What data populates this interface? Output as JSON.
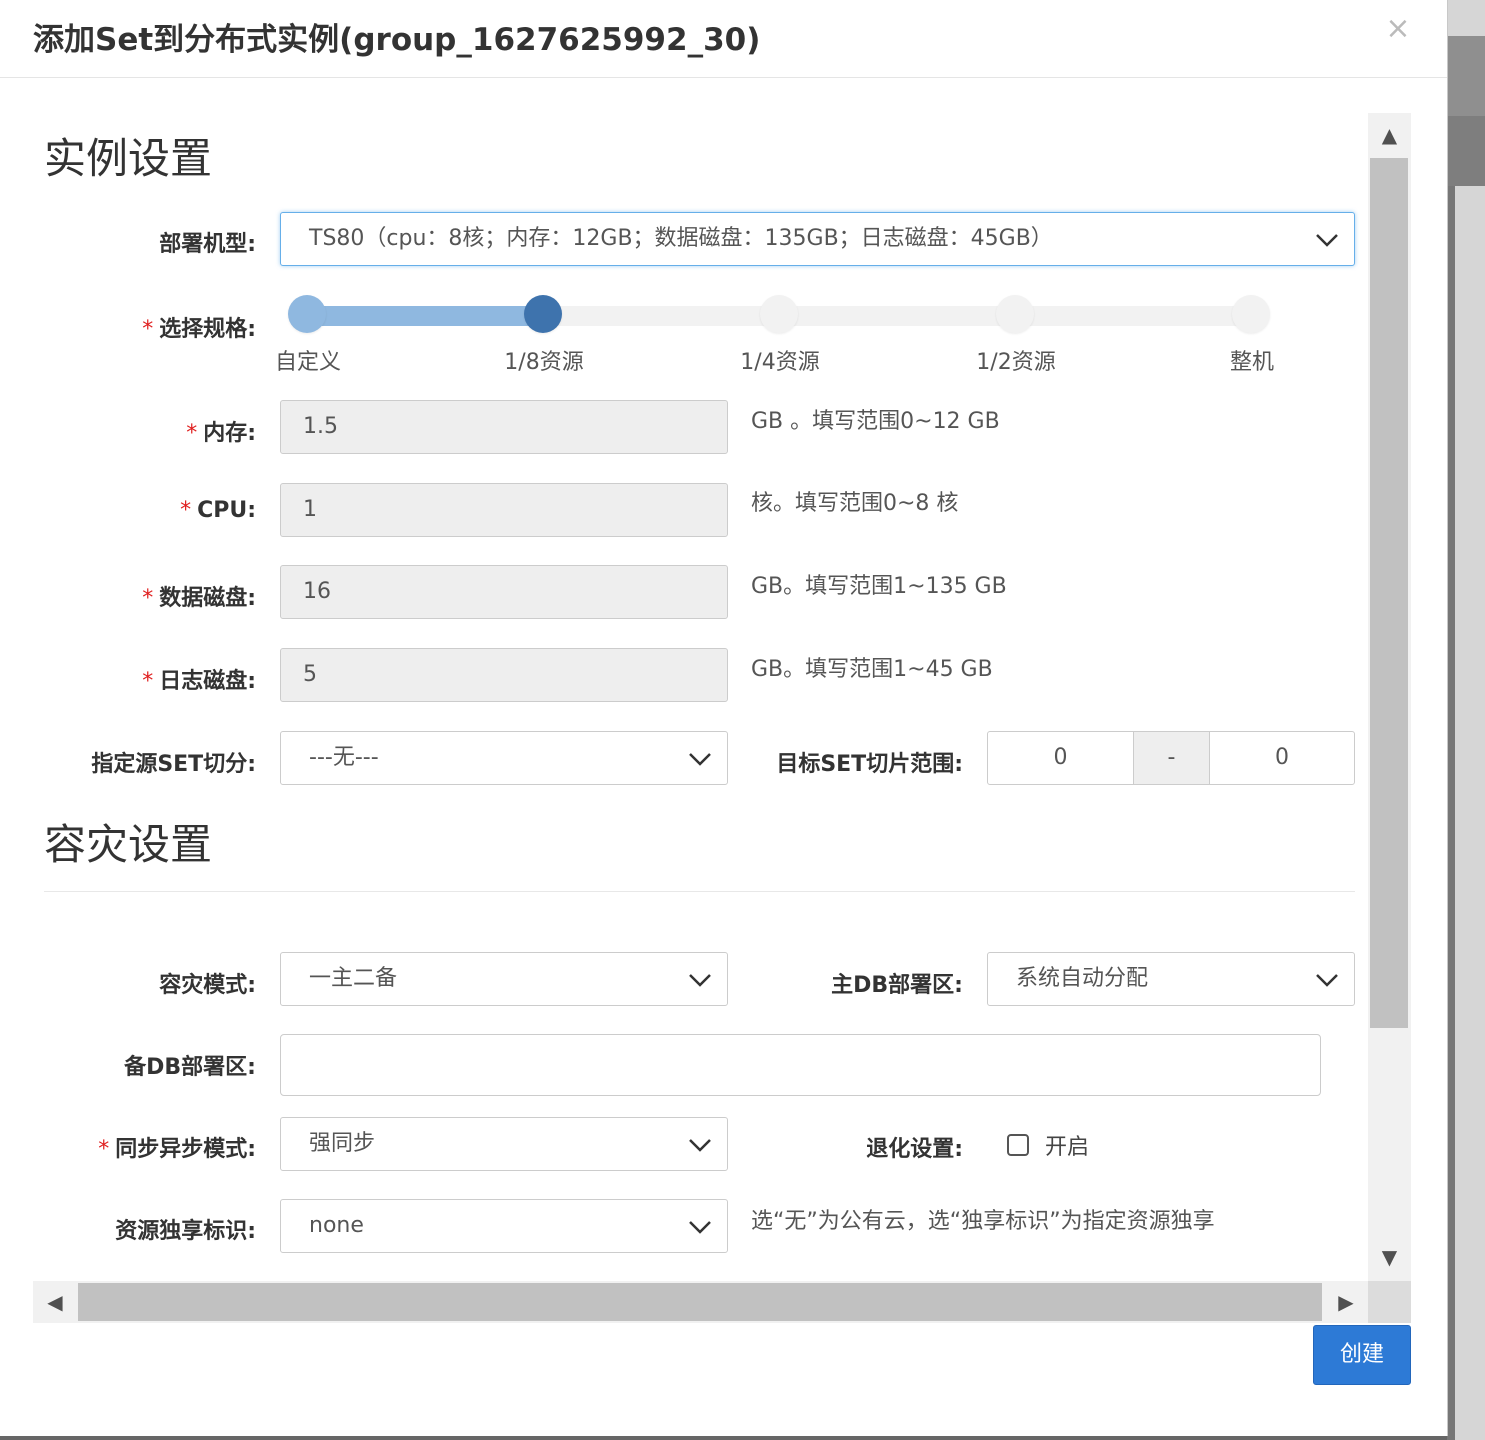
{
  "dialog": {
    "title": "添加Set到分布式实例(group_1627625992_30)",
    "close_glyph": "×",
    "create_label": "创建"
  },
  "instance_section": {
    "title": "实例设置",
    "machine_type": {
      "label": "部署机型:",
      "value": "TS80（cpu：8核；内存：12GB；数据磁盘：135GB；日志磁盘：45GB）"
    },
    "spec": {
      "label": "选择规格:",
      "options": [
        "自定义",
        "1/8资源",
        "1/4资源",
        "1/2资源",
        "整机"
      ],
      "selected_index": 1
    },
    "memory": {
      "label": "内存:",
      "value": "1.5",
      "hint": "GB 。填写范围0~12 GB"
    },
    "cpu": {
      "label": "CPU:",
      "value": "1",
      "hint": "核。填写范围0~8 核"
    },
    "data_disk": {
      "label": "数据磁盘:",
      "value": "16",
      "hint": "GB。填写范围1~135 GB"
    },
    "log_disk": {
      "label": "日志磁盘:",
      "value": "5",
      "hint": "GB。填写范围1~45 GB"
    },
    "source_set": {
      "label": "指定源SET切分:",
      "value": "---无---"
    },
    "target_range": {
      "label": "目标SET切片范围:",
      "from": "0",
      "separator": "-",
      "to": "0"
    }
  },
  "dr_section": {
    "title": "容灾设置",
    "dr_mode": {
      "label": "容灾模式:",
      "value": "一主二备"
    },
    "master_zone": {
      "label": "主DB部署区:",
      "value": "系统自动分配"
    },
    "standby_zone": {
      "label": "备DB部署区:",
      "value": ""
    },
    "sync_mode": {
      "label": "同步异步模式:",
      "value": "强同步"
    },
    "degrade": {
      "label": "退化设置:",
      "checkbox_label": "开启",
      "checked": false
    },
    "exclusive": {
      "label": "资源独享标识:",
      "value": "none",
      "hint": "选“无”为公有云，选“独享标识”为指定资源独享"
    }
  },
  "colors": {
    "primary": "#2d7ad6",
    "required": "#e02020",
    "slider_active": "#3e73ad",
    "slider_fill": "#8fb8e0"
  }
}
